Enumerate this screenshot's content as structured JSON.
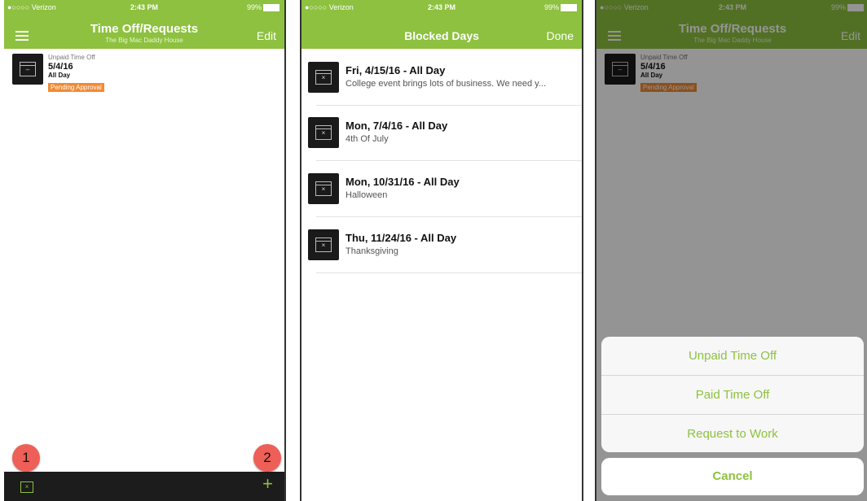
{
  "status_bar": {
    "carrier": "Verizon",
    "time": "2:43 PM",
    "battery": "99%"
  },
  "screen1": {
    "title": "Time Off/Requests",
    "subtitle": "The Big Mac Daddy House",
    "edit_label": "Edit",
    "request": {
      "type": "Unpaid Time Off",
      "date": "5/4/16",
      "duration": "All Day",
      "status": "Pending Approval"
    },
    "markers": [
      "1",
      "2"
    ],
    "toolbar": {
      "plus_label": "+"
    }
  },
  "screen2": {
    "title": "Blocked Days",
    "done_label": "Done",
    "items": [
      {
        "title": "Fri, 4/15/16 - All Day",
        "desc": "College event brings lots of business. We need y..."
      },
      {
        "title": "Mon, 7/4/16 - All Day",
        "desc": "4th Of July"
      },
      {
        "title": "Mon, 10/31/16 - All Day",
        "desc": "Halloween"
      },
      {
        "title": "Thu, 11/24/16 - All Day",
        "desc": "Thanksgiving"
      }
    ]
  },
  "screen3": {
    "title": "Time Off/Requests",
    "subtitle": "The Big Mac Daddy House",
    "edit_label": "Edit",
    "request": {
      "type": "Unpaid Time Off",
      "date": "5/4/16",
      "duration": "All Day",
      "status": "Pending Approval"
    },
    "sheet_options": [
      "Unpaid Time Off",
      "Paid Time Off",
      "Request to Work"
    ],
    "cancel_label": "Cancel"
  },
  "colors": {
    "accent": "#8dc13f",
    "pending": "#f08a35",
    "marker": "#ee5f57",
    "toolbar": "#1c1c1c"
  }
}
